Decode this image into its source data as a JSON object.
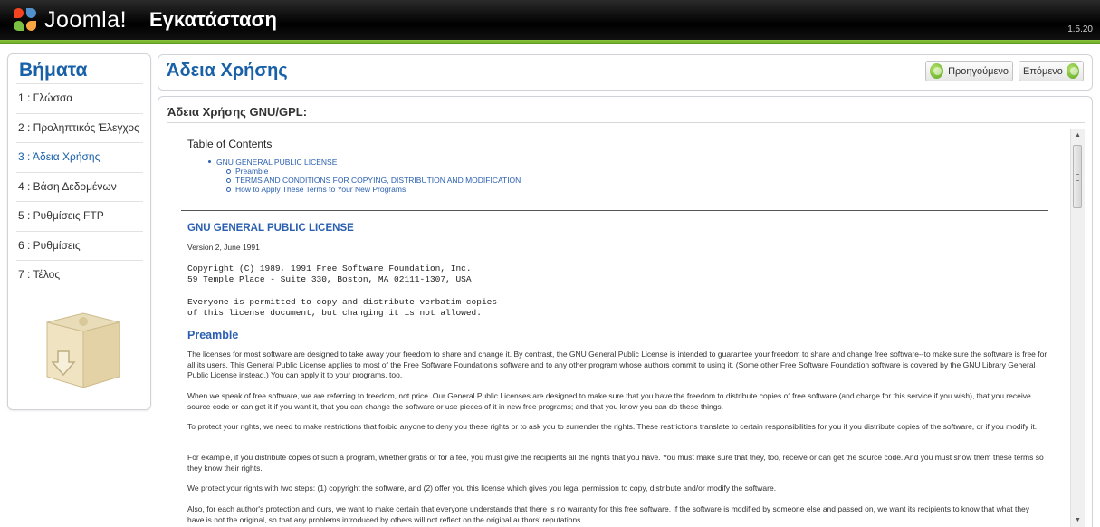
{
  "header": {
    "logo_text": "Joomla!",
    "title": "Εγκατάσταση",
    "version": "1.5.20"
  },
  "sidebar": {
    "title": "Βήματα",
    "steps": [
      {
        "label": "1 : Γλώσσα"
      },
      {
        "label": "2 : Προληπτικός Έλεγχος"
      },
      {
        "label": "3 : Άδεια Χρήσης"
      },
      {
        "label": "4 : Βάση Δεδομένων"
      },
      {
        "label": "5 : Ρυθμίσεις FTP"
      },
      {
        "label": "6 : Ρυθμίσεις"
      },
      {
        "label": "7 : Τέλος"
      }
    ],
    "active_step": 3,
    "box_icon": "install-box-icon"
  },
  "main": {
    "title": "Άδεια Χρήσης",
    "prev_label": "Προηγούμενο",
    "next_label": "Επόμενο",
    "section_title": "Άδεια Χρήσης GNU/GPL:"
  },
  "license": {
    "toc_title": "Table of Contents",
    "toc_main": "GNU GENERAL PUBLIC LICENSE",
    "toc_sub": [
      "Preamble",
      "TERMS AND CONDITIONS FOR COPYING, DISTRIBUTION AND MODIFICATION",
      "How to Apply These Terms to Your New Programs"
    ],
    "heading": "GNU GENERAL PUBLIC LICENSE",
    "version": "Version 2, June 1991",
    "copyright_1": "Copyright (C) 1989, 1991 Free Software Foundation, Inc.",
    "copyright_2": "59 Temple Place - Suite 330, Boston, MA  02111-1307, USA",
    "permit_1": "Everyone is permitted to copy and distribute verbatim copies",
    "permit_2": "of this license document, but changing it is not allowed.",
    "preamble_title": "Preamble",
    "paragraphs": [
      "The licenses for most software are designed to take away your freedom to share and change it. By contrast, the GNU General Public License is intended to guarantee your freedom to share and change free software--to make sure the software is free for all its users. This General Public License applies to most of the Free Software Foundation's software and to any other program whose authors commit to using it. (Some other Free Software Foundation software is covered by the GNU Library General Public License instead.) You can apply it to your programs, too.",
      "When we speak of free software, we are referring to freedom, not price. Our General Public Licenses are designed to make sure that you have the freedom to distribute copies of free software (and charge for this service if you wish), that you receive source code or can get it if you want it, that you can change the software or use pieces of it in new free programs; and that you know you can do these things.",
      "To protect your rights, we need to make restrictions that forbid anyone to deny you these rights or to ask you to surrender the rights. These restrictions translate to certain responsibilities for you if you distribute copies of the software, or if you modify it.",
      "For example, if you distribute copies of such a program, whether gratis or for a fee, you must give the recipients all the rights that you have. You must make sure that they, too, receive or can get the source code. And you must show them these terms so they know their rights.",
      "We protect your rights with two steps: (1) copyright the software, and (2) offer you this license which gives you legal permission to copy, distribute and/or modify the software.",
      "Also, for each author's protection and ours, we want to make certain that everyone understands that there is no warranty for this free software. If the software is modified by someone else and passed on, we want its recipients to know that what they have is not the original, so that any problems introduced by others will not reflect on the original authors' reputations."
    ]
  },
  "colors": {
    "accent": "#1860a8",
    "link": "#2a5fb0",
    "green": "#8cc63f"
  }
}
